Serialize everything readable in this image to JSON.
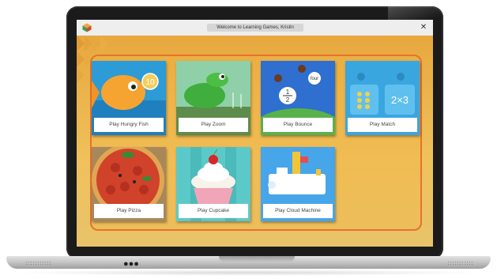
{
  "window": {
    "title": "Welcome to Learning Games, Kristin",
    "close_label": "✕"
  },
  "games": [
    {
      "id": "hungry-fish",
      "label": "Play Hungry Fish",
      "badge": "10"
    },
    {
      "id": "zoom",
      "label": "Play Zoom"
    },
    {
      "id": "bounce",
      "label": "Play Bounce",
      "fraction_num": "1",
      "fraction_den": "2",
      "word": "four"
    },
    {
      "id": "match",
      "label": "Play Match",
      "expression": "2×3"
    },
    {
      "id": "pizza",
      "label": "Play Pizza"
    },
    {
      "id": "cupcake",
      "label": "Play Cupcake"
    },
    {
      "id": "cloud-machine",
      "label": "Play Cloud Machine"
    }
  ],
  "laptop": {
    "dots": "●●●"
  },
  "colors": {
    "background": "#e9b64f",
    "panel_border": "#e8712c",
    "titlebar": "#eeeeee"
  }
}
